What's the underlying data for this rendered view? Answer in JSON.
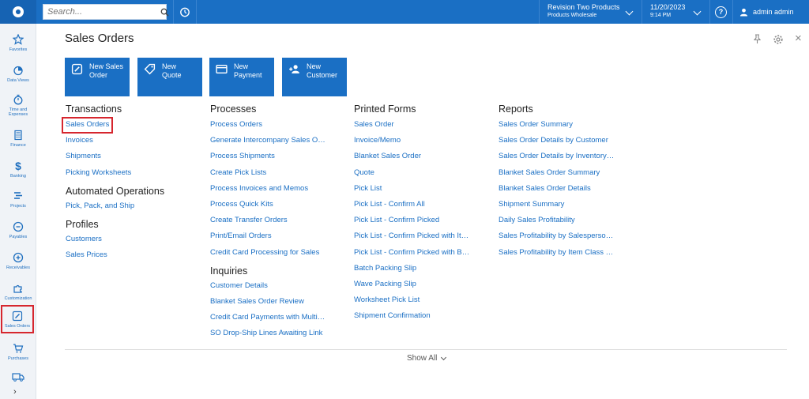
{
  "topbar": {
    "search_placeholder": "Search...",
    "company_line1": "Revision Two Products",
    "company_line2": "Products Wholesale",
    "date": "11/20/2023",
    "time": "9:14 PM",
    "user": "admin admin"
  },
  "sidebar": {
    "items": [
      {
        "label": "Favorites",
        "icon": "star-icon"
      },
      {
        "label": "Data Views",
        "icon": "pie-chart-icon"
      },
      {
        "label": "Time and Expenses",
        "icon": "stopwatch-icon"
      },
      {
        "label": "Finance",
        "icon": "calculator-icon"
      },
      {
        "label": "Banking",
        "icon": "dollar-icon"
      },
      {
        "label": "Projects",
        "icon": "projects-icon"
      },
      {
        "label": "Payables",
        "icon": "minus-circle-icon"
      },
      {
        "label": "Receivables",
        "icon": "plus-circle-icon"
      },
      {
        "label": "Customization",
        "icon": "puzzle-icon"
      },
      {
        "label": "Sales Orders",
        "icon": "edit-icon"
      },
      {
        "label": "Purchases",
        "icon": "cart-icon"
      },
      {
        "label": "",
        "icon": "truck-icon"
      }
    ]
  },
  "page": {
    "title": "Sales Orders"
  },
  "tiles": [
    {
      "line1": "New Sales",
      "line2": "Order",
      "icon": "edit-icon"
    },
    {
      "line1": "New",
      "line2": "Quote",
      "icon": "tag-icon"
    },
    {
      "line1": "New",
      "line2": "Payment",
      "icon": "card-icon"
    },
    {
      "line1": "New",
      "line2": "Customer",
      "icon": "add-user-icon"
    }
  ],
  "columns": {
    "c1": {
      "transactions_title": "Transactions",
      "transactions": [
        "Sales Orders",
        "Invoices",
        "Shipments",
        "Picking Worksheets"
      ],
      "automated_title": "Automated Operations",
      "automated": [
        "Pick, Pack, and Ship"
      ],
      "profiles_title": "Profiles",
      "profiles": [
        "Customers",
        "Sales Prices"
      ]
    },
    "c2": {
      "processes_title": "Processes",
      "processes": [
        "Process Orders",
        "Generate Intercompany Sales O…",
        "Process Shipments",
        "Create Pick Lists",
        "Process Invoices and Memos",
        "Process Quick Kits",
        "Create Transfer Orders",
        "Print/Email Orders",
        "Credit Card Processing for Sales"
      ],
      "inquiries_title": "Inquiries",
      "inquiries": [
        "Customer Details",
        "Blanket Sales Order Review",
        "Credit Card Payments with Multi…",
        "SO Drop-Ship Lines Awaiting Link"
      ]
    },
    "c3": {
      "printed_title": "Printed Forms",
      "printed": [
        "Sales Order",
        "Invoice/Memo",
        "Blanket Sales Order",
        "Quote",
        "Pick List",
        "Pick List - Confirm All",
        "Pick List - Confirm Picked",
        "Pick List - Confirm Picked with It…",
        "Pick List - Confirm Picked with B…",
        "Batch Packing Slip",
        "Wave Packing Slip",
        "Worksheet Pick List",
        "Shipment Confirmation"
      ]
    },
    "c4": {
      "reports_title": "Reports",
      "reports": [
        "Sales Order Summary",
        "Sales Order Details by Customer",
        "Sales Order Details by Inventory…",
        "Blanket Sales Order Summary",
        "Blanket Sales Order Details",
        "Shipment Summary",
        "Daily Sales Profitability",
        "Sales Profitability by Salesperso…",
        "Sales Profitability by Item Class …"
      ]
    }
  },
  "footer": {
    "show_all": "Show All"
  },
  "colors": {
    "brand": "#1a6fc4",
    "highlight": "#d6262e"
  }
}
